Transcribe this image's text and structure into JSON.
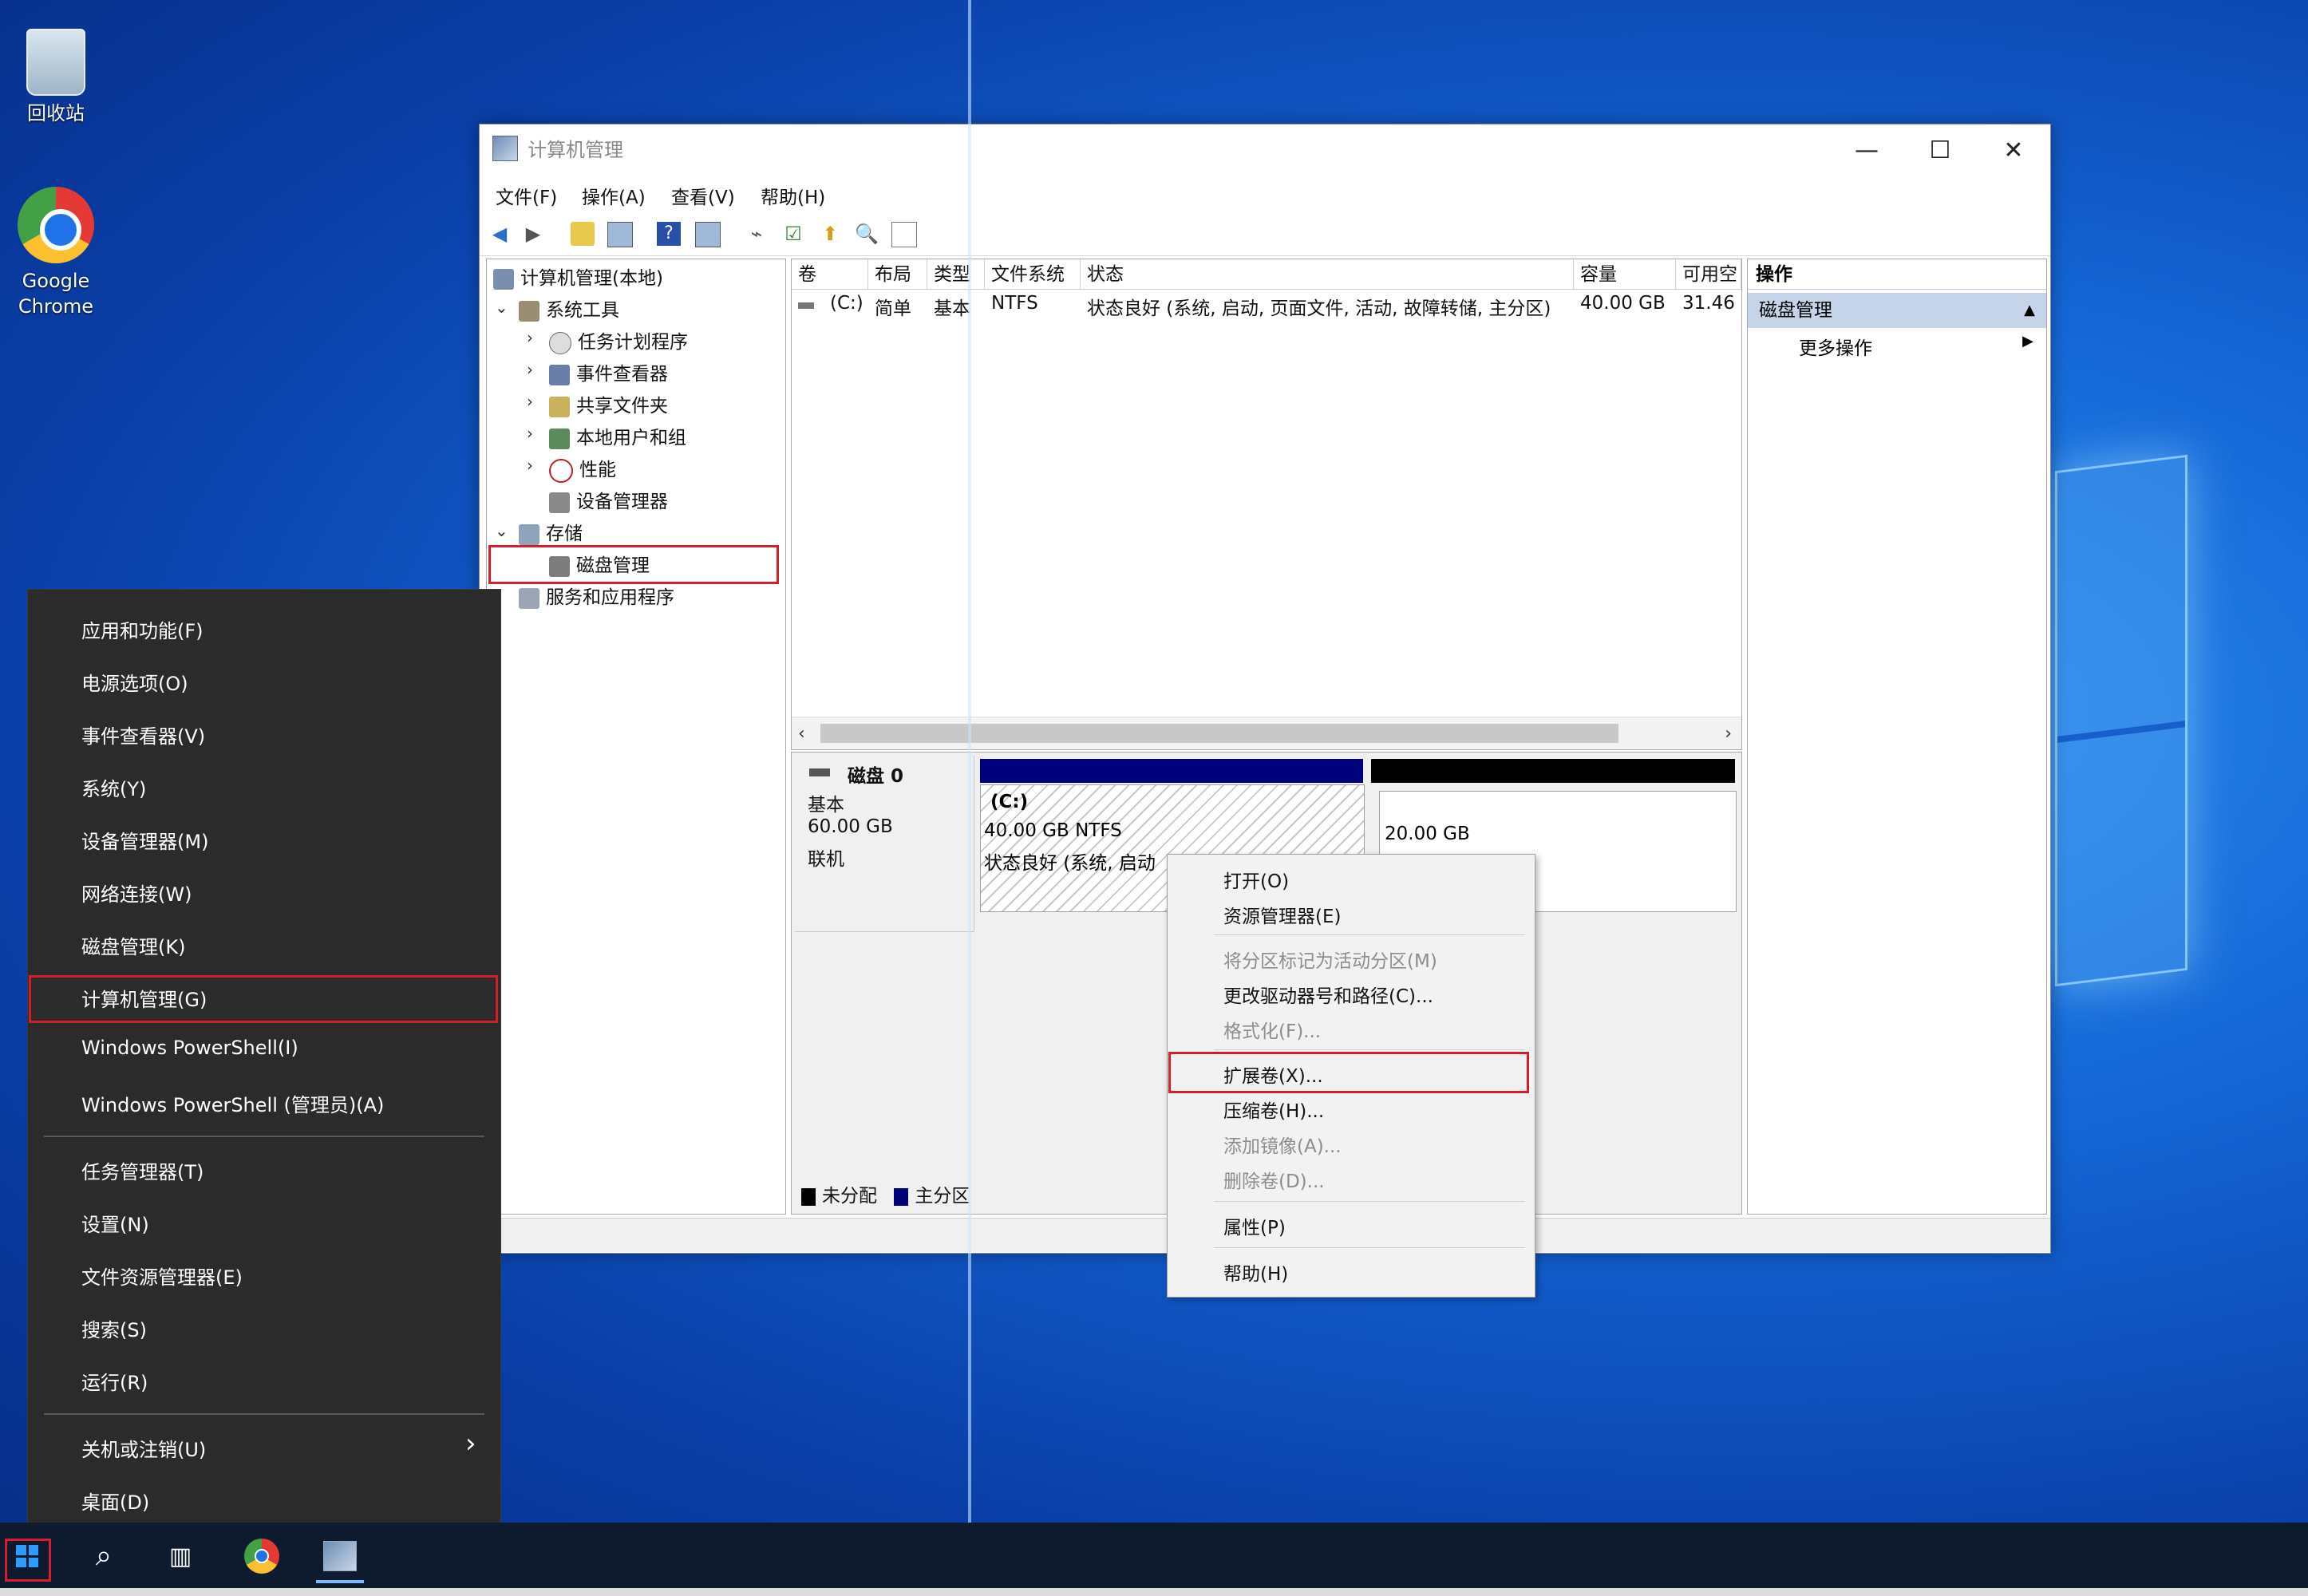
{
  "desktop": {
    "recycle_bin": "回收站",
    "chrome_line1": "Google",
    "chrome_line2": "Chrome"
  },
  "window": {
    "title": "计算机管理",
    "controls": {
      "minimize": "—",
      "maximize": "☐",
      "close": "✕"
    },
    "menu": [
      "文件(F)",
      "操作(A)",
      "查看(V)",
      "帮助(H)"
    ]
  },
  "tree": {
    "root": "计算机管理(本地)",
    "system_tools": "系统工具",
    "task_scheduler": "任务计划程序",
    "event_viewer": "事件查看器",
    "shared_folders": "共享文件夹",
    "local_users": "本地用户和组",
    "performance": "性能",
    "device_manager": "设备管理器",
    "storage": "存储",
    "disk_management": "磁盘管理",
    "services": "服务和应用程序"
  },
  "volume_list": {
    "headers": [
      "卷",
      "布局",
      "类型",
      "文件系统",
      "状态",
      "容量",
      "可用空"
    ],
    "rows": [
      {
        "volume": "(C:)",
        "layout": "简单",
        "type": "基本",
        "fs": "NTFS",
        "status": "状态良好 (系统, 启动, 页面文件, 活动, 故障转储, 主分区)",
        "capacity": "40.00 GB",
        "free": "31.46"
      }
    ]
  },
  "disk": {
    "name": "磁盘 0",
    "type": "基本",
    "size": "60.00 GB",
    "state": "联机",
    "partition_c": {
      "label": "(C:)",
      "size": "40.00 GB NTFS",
      "status": "状态良好 (系统, 启动"
    },
    "unallocated": {
      "size": "20.00 GB"
    },
    "legend": [
      "未分配",
      "主分区"
    ]
  },
  "actions": {
    "header": "操作",
    "section": "磁盘管理",
    "more": "更多操作"
  },
  "context_menu": [
    {
      "label": "打开(O)",
      "disabled": false
    },
    {
      "label": "资源管理器(E)",
      "disabled": false
    },
    {
      "label": "将分区标记为活动分区(M)",
      "disabled": true
    },
    {
      "label": "更改驱动器号和路径(C)...",
      "disabled": false
    },
    {
      "label": "格式化(F)...",
      "disabled": true
    },
    {
      "label": "扩展卷(X)...",
      "disabled": false
    },
    {
      "label": "压缩卷(H)...",
      "disabled": false
    },
    {
      "label": "添加镜像(A)...",
      "disabled": true
    },
    {
      "label": "删除卷(D)...",
      "disabled": true
    },
    {
      "label": "属性(P)",
      "disabled": false
    },
    {
      "label": "帮助(H)",
      "disabled": false
    }
  ],
  "power_menu": [
    "应用和功能(F)",
    "电源选项(O)",
    "事件查看器(V)",
    "系统(Y)",
    "设备管理器(M)",
    "网络连接(W)",
    "磁盘管理(K)",
    "计算机管理(G)",
    "Windows PowerShell(I)",
    "Windows PowerShell (管理员)(A)",
    "任务管理器(T)",
    "设置(N)",
    "文件资源管理器(E)",
    "搜索(S)",
    "运行(R)",
    "关机或注销(U)",
    "桌面(D)"
  ],
  "power_menu_arrow": "›",
  "colors": {
    "primary_partition": "#00007b",
    "unallocated": "#000000",
    "highlight": "#d21f2b",
    "actions_header_bg": "#c5d4e9"
  }
}
